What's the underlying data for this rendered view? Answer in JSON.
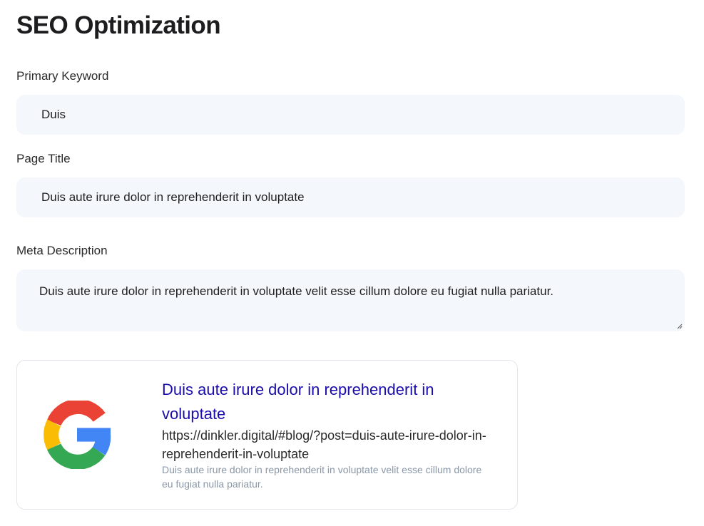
{
  "page": {
    "title": "SEO Optimization"
  },
  "form": {
    "primary_keyword": {
      "label": "Primary Keyword",
      "value": "Duis"
    },
    "page_title": {
      "label": "Page Title",
      "value": "Duis aute irure dolor in reprehenderit in voluptate"
    },
    "meta_description": {
      "label": "Meta Description",
      "value": "Duis aute irure dolor in reprehenderit in voluptate velit esse cillum dolore eu fugiat nulla pariatur."
    }
  },
  "preview": {
    "logo_icon": "google-logo-icon",
    "title": "Duis aute irure dolor in reprehenderit in voluptate",
    "url": "https://dinkler.digital/#blog/?post=duis-aute-irure-dolor-in-reprehenderit-in-voluptate",
    "description": "Duis aute irure dolor in reprehenderit in voluptate velit esse cillum dolore eu fugiat nulla pariatur.",
    "colors": {
      "title": "#1a0dab",
      "description": "#8a97a6"
    }
  },
  "colors": {
    "field_background": "#f4f7fb",
    "google_red": "#ea4335",
    "google_yellow": "#fbbc05",
    "google_green": "#34a853",
    "google_blue": "#4285f4"
  }
}
